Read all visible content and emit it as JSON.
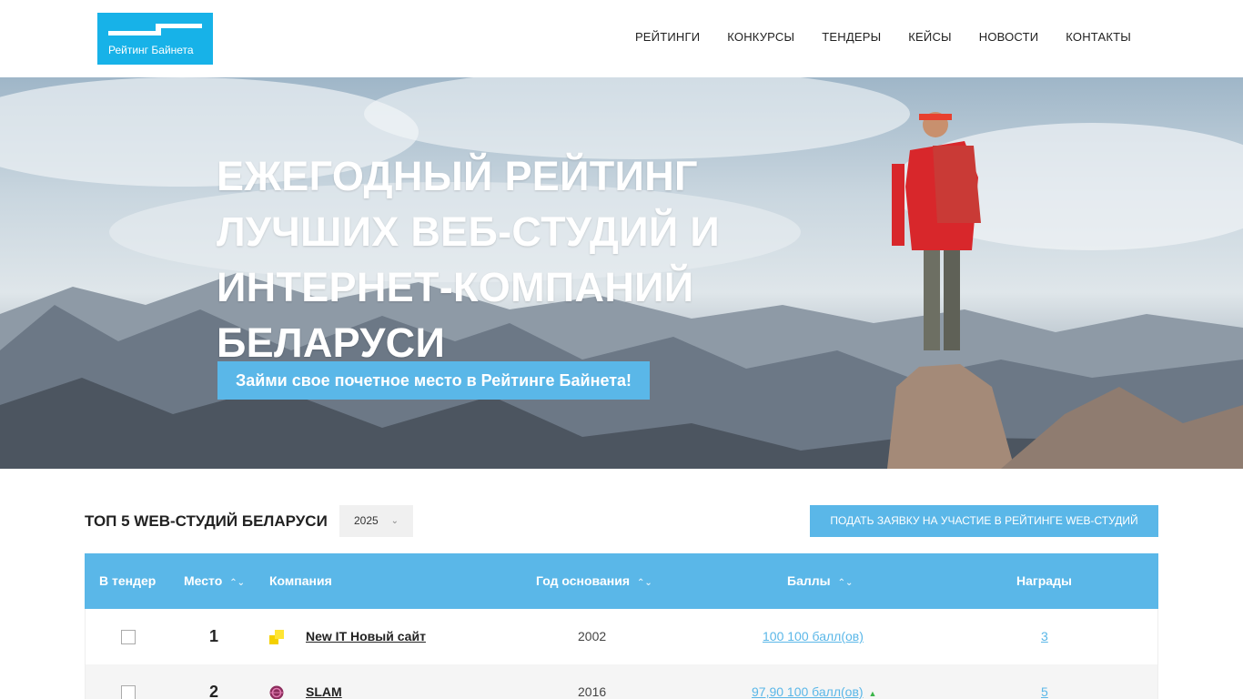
{
  "header": {
    "logo_text": "Рейтинг Байнета",
    "nav": [
      "РЕЙТИНГИ",
      "КОНКУРСЫ",
      "ТЕНДЕРЫ",
      "КЕЙСЫ",
      "НОВОСТИ",
      "КОНТАКТЫ"
    ]
  },
  "hero": {
    "title_lines": [
      "ЕЖЕГОДНЫЙ РЕЙТИНГ",
      "ЛУЧШИХ ВЕБ-СТУДИЙ И",
      "ИНТЕРНЕТ-КОМПАНИЙ",
      "БЕЛАРУСИ"
    ],
    "cta": "Займи свое почетное место в Рейтинге Байнета!"
  },
  "top": {
    "title": "ТОП 5 WEB-СТУДИЙ БЕЛАРУСИ",
    "year": "2025",
    "apply_button": "ПОДАТЬ ЗАЯВКУ НА УЧАСТИЕ В РЕЙТИНГЕ WEB-СТУДИЙ"
  },
  "table": {
    "headers": {
      "tender": "В тендер",
      "place": "Место",
      "company": "Компания",
      "founded": "Год основания",
      "score": "Баллы",
      "awards": "Награды"
    },
    "rows": [
      {
        "place": "1",
        "company": "New IT Новый сайт",
        "founded": "2002",
        "score": "100 100 балл(ов)",
        "awards": "3",
        "trend": ""
      },
      {
        "place": "2",
        "company": "SLAM",
        "founded": "2016",
        "score": "97,90 100 балл(ов)",
        "awards": "5",
        "trend": "up"
      }
    ]
  },
  "colors": {
    "brand": "#17b2e8",
    "accent": "#5ab7e8",
    "trend_up": "#3bb54a"
  }
}
